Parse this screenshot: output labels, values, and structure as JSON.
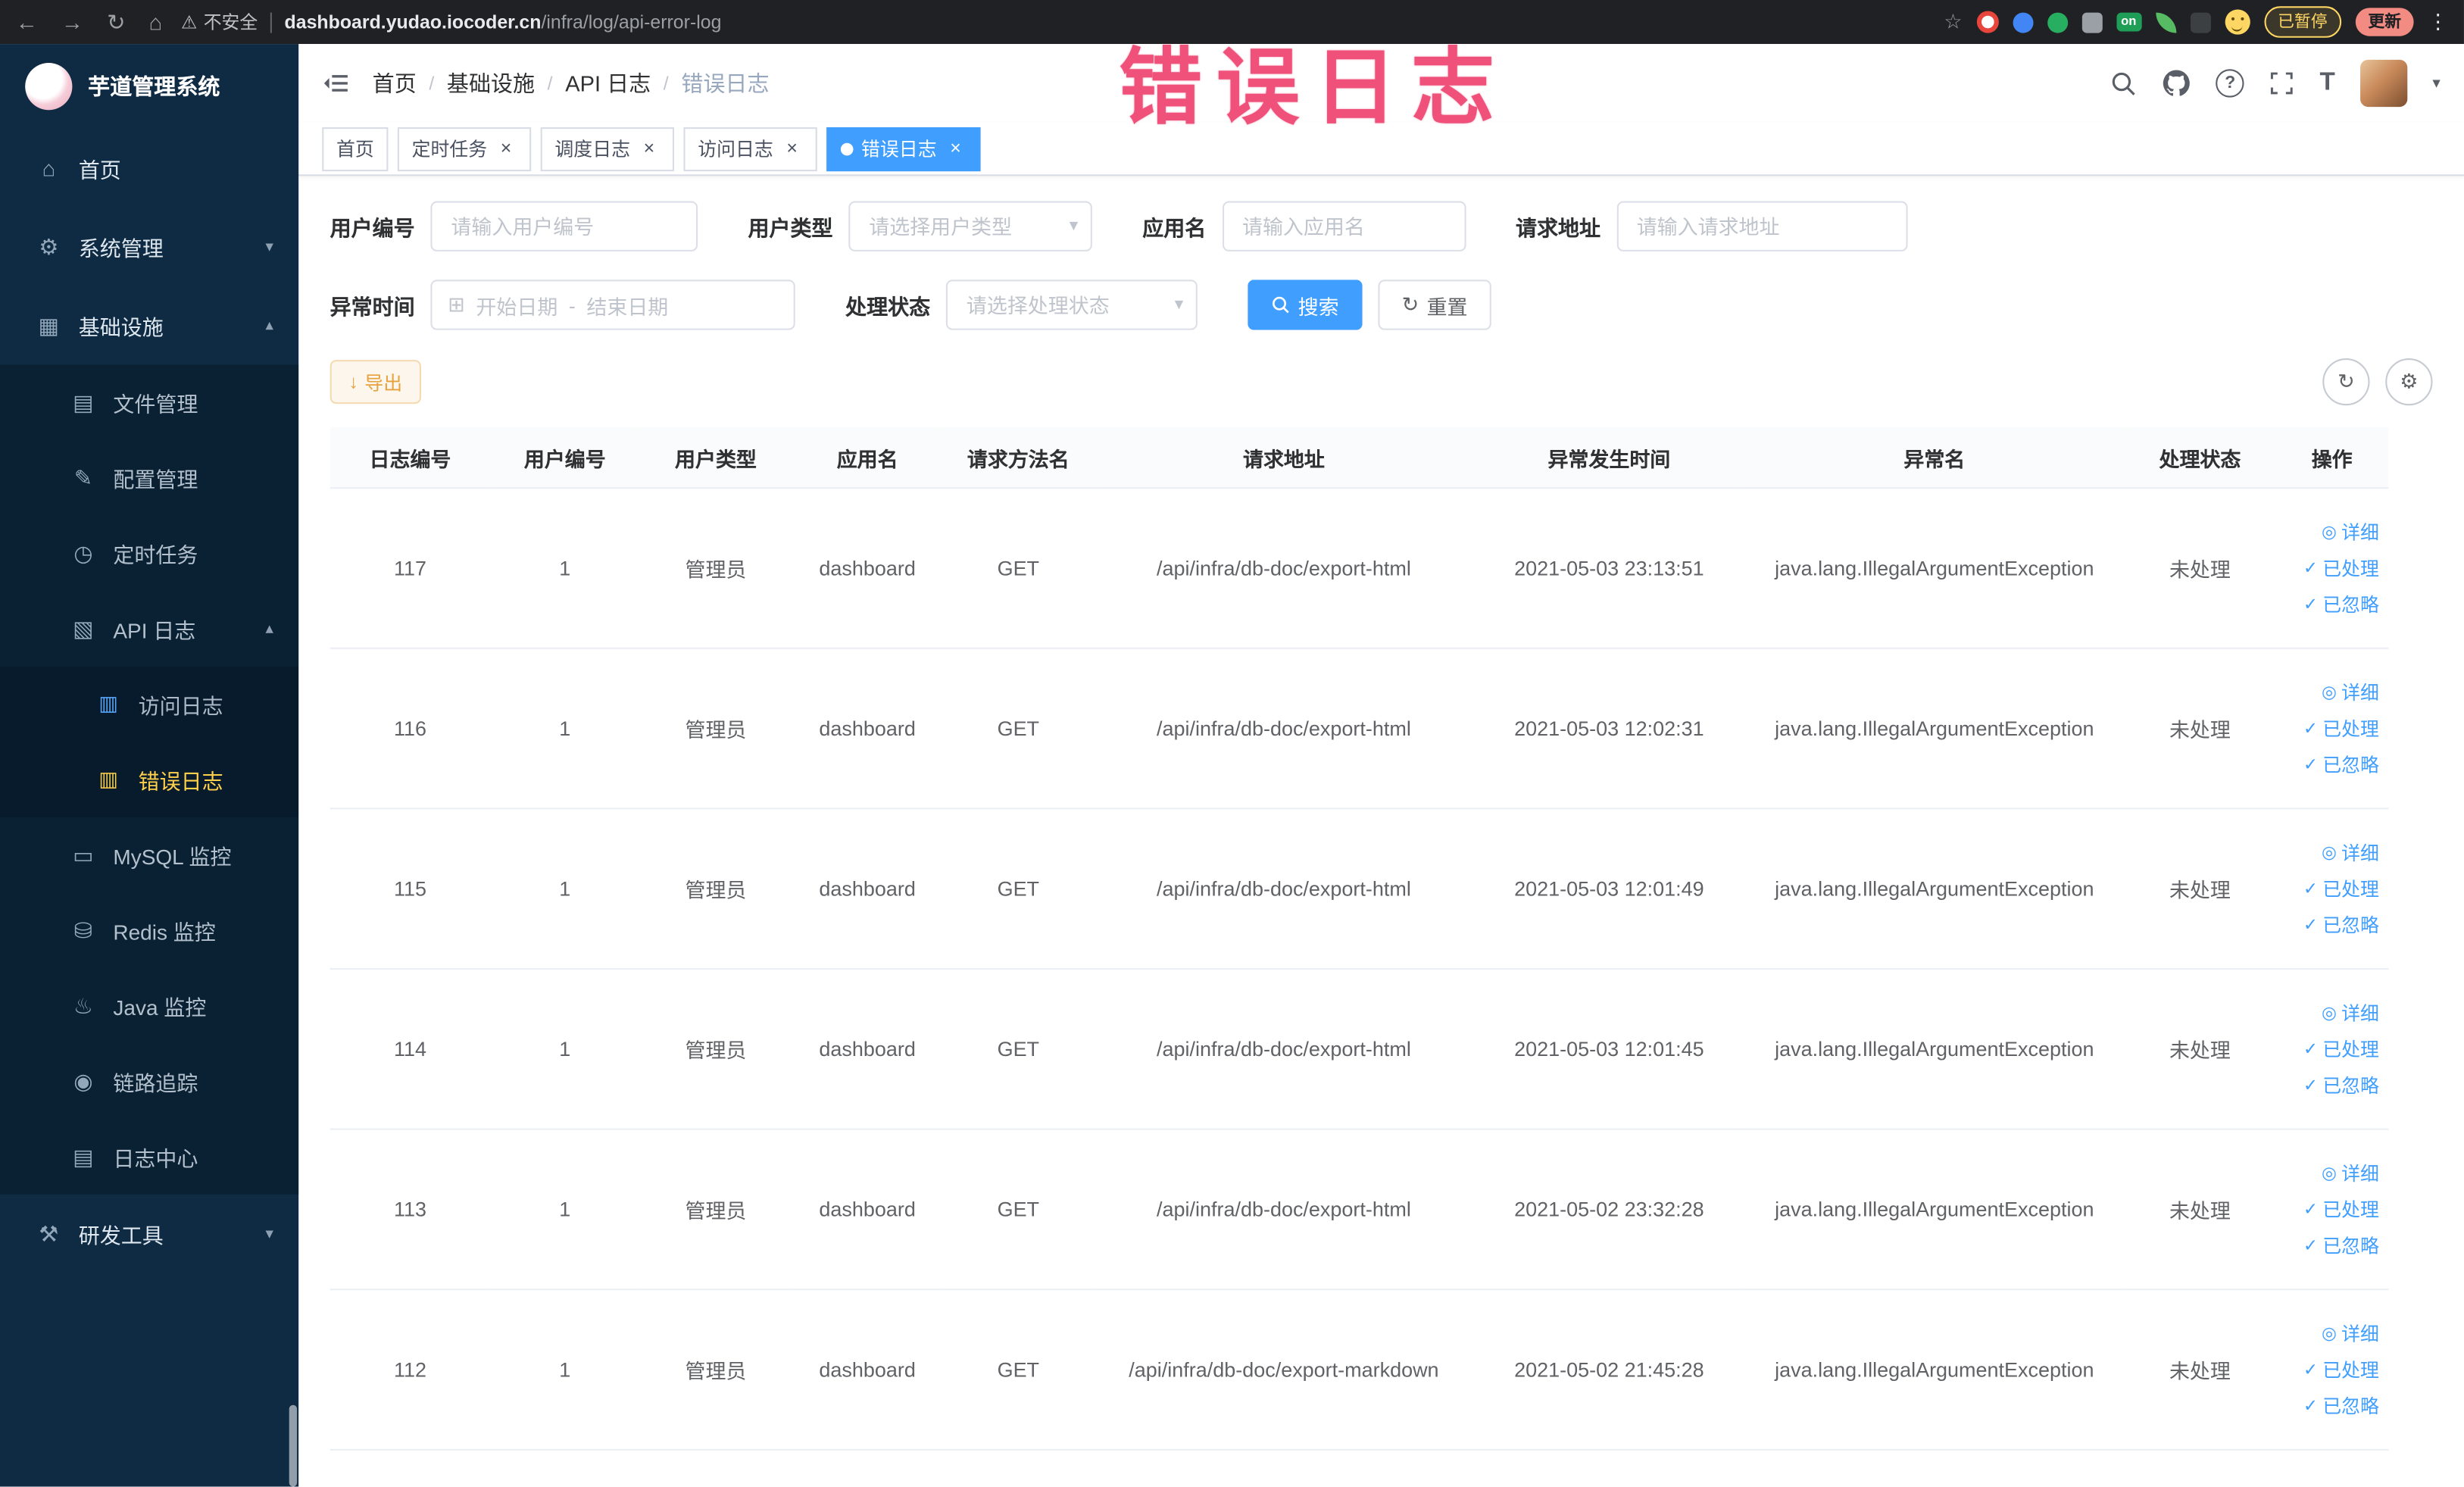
{
  "browser": {
    "security_label": "不安全",
    "url_host": "dashboard.yudao.iocoder.cn",
    "url_path": "/infra/log/api-error-log",
    "ext_on_label": "on",
    "paused_label": "已暂停",
    "update_label": "更新"
  },
  "annotation": {
    "text": "错误日志",
    "color": "#f0517a"
  },
  "icons": {
    "back": "←",
    "forward": "→",
    "reload": "↻",
    "home_nav": "⌂",
    "warning": "⚠",
    "star": "☆",
    "dots_menu": "⋮",
    "home": "⌂",
    "system": "⚙",
    "infra": "▦",
    "file": "▤",
    "config": "✎",
    "job": "◷",
    "apilog": "▧",
    "accesslog": "▥",
    "errorlog": "▥",
    "mysql": "▭",
    "redis": "⛁",
    "java": "♨",
    "trace": "◉",
    "logcenter": "▤",
    "devtool": "⚒",
    "arrow_down": "▾",
    "arrow_up": "▴",
    "caret_down": "▾",
    "close": "×",
    "check": "✓",
    "eye": "◎",
    "download": "↓",
    "calendar": "⊞",
    "refresh": "↻",
    "columns": "⚙",
    "question": "?",
    "fontsize": "T"
  },
  "sidebar": {
    "logo_title": "芋道管理系统",
    "items": [
      {
        "label": "首页"
      },
      {
        "label": "系统管理"
      },
      {
        "label": "基础设施"
      },
      {
        "label": "文件管理"
      },
      {
        "label": "配置管理"
      },
      {
        "label": "定时任务"
      },
      {
        "label": "API 日志"
      },
      {
        "label": "访问日志"
      },
      {
        "label": "错误日志"
      },
      {
        "label": "MySQL 监控"
      },
      {
        "label": "Redis 监控"
      },
      {
        "label": "Java 监控"
      },
      {
        "label": "链路追踪"
      },
      {
        "label": "日志中心"
      },
      {
        "label": "研发工具"
      }
    ]
  },
  "breadcrumb": {
    "separator": "/",
    "items": [
      "首页",
      "基础设施",
      "API 日志",
      "错误日志"
    ]
  },
  "tabs": [
    {
      "label": "首页"
    },
    {
      "label": "定时任务"
    },
    {
      "label": "调度日志"
    },
    {
      "label": "访问日志"
    },
    {
      "label": "错误日志"
    }
  ],
  "filters": {
    "user_id": {
      "label": "用户编号",
      "placeholder": "请输入用户编号"
    },
    "user_type": {
      "label": "用户类型",
      "placeholder": "请选择用户类型"
    },
    "app_name": {
      "label": "应用名",
      "placeholder": "请输入应用名"
    },
    "request_url": {
      "label": "请求地址",
      "placeholder": "请输入请求地址"
    },
    "exception_time": {
      "label": "异常时间",
      "start_placeholder": "开始日期",
      "separator": "-",
      "end_placeholder": "结束日期"
    },
    "process_status": {
      "label": "处理状态",
      "placeholder": "请选择处理状态"
    },
    "search_label": "搜索",
    "reset_label": "重置"
  },
  "toolbar": {
    "export_label": "导出"
  },
  "table": {
    "headers": [
      "日志编号",
      "用户编号",
      "用户类型",
      "应用名",
      "请求方法名",
      "请求地址",
      "异常发生时间",
      "异常名",
      "处理状态",
      "操作"
    ],
    "action_labels": {
      "detail": "详细",
      "processed": "已处理",
      "ignored": "已忽略"
    },
    "rows": [
      {
        "id": "117",
        "user_id": "1",
        "user_type": "管理员",
        "app": "dashboard",
        "method": "GET",
        "url": "/api/infra/db-doc/export-html",
        "time": "2021-05-03 23:13:51",
        "exception": "java.lang.IllegalArgumentException",
        "status": "未处理"
      },
      {
        "id": "116",
        "user_id": "1",
        "user_type": "管理员",
        "app": "dashboard",
        "method": "GET",
        "url": "/api/infra/db-doc/export-html",
        "time": "2021-05-03 12:02:31",
        "exception": "java.lang.IllegalArgumentException",
        "status": "未处理"
      },
      {
        "id": "115",
        "user_id": "1",
        "user_type": "管理员",
        "app": "dashboard",
        "method": "GET",
        "url": "/api/infra/db-doc/export-html",
        "time": "2021-05-03 12:01:49",
        "exception": "java.lang.IllegalArgumentException",
        "status": "未处理"
      },
      {
        "id": "114",
        "user_id": "1",
        "user_type": "管理员",
        "app": "dashboard",
        "method": "GET",
        "url": "/api/infra/db-doc/export-html",
        "time": "2021-05-03 12:01:45",
        "exception": "java.lang.IllegalArgumentException",
        "status": "未处理"
      },
      {
        "id": "113",
        "user_id": "1",
        "user_type": "管理员",
        "app": "dashboard",
        "method": "GET",
        "url": "/api/infra/db-doc/export-html",
        "time": "2021-05-02 23:32:28",
        "exception": "java.lang.IllegalArgumentException",
        "status": "未处理"
      },
      {
        "id": "112",
        "user_id": "1",
        "user_type": "管理员",
        "app": "dashboard",
        "method": "GET",
        "url": "/api/infra/db-doc/export-markdown",
        "time": "2021-05-02 21:45:28",
        "exception": "java.lang.IllegalArgumentException",
        "status": "未处理"
      }
    ]
  },
  "colors": {
    "accent": "#409eff",
    "sidebar_bg": "#0e2b43",
    "active_menu": "#ffd04b",
    "warning": "#e6a23c"
  }
}
